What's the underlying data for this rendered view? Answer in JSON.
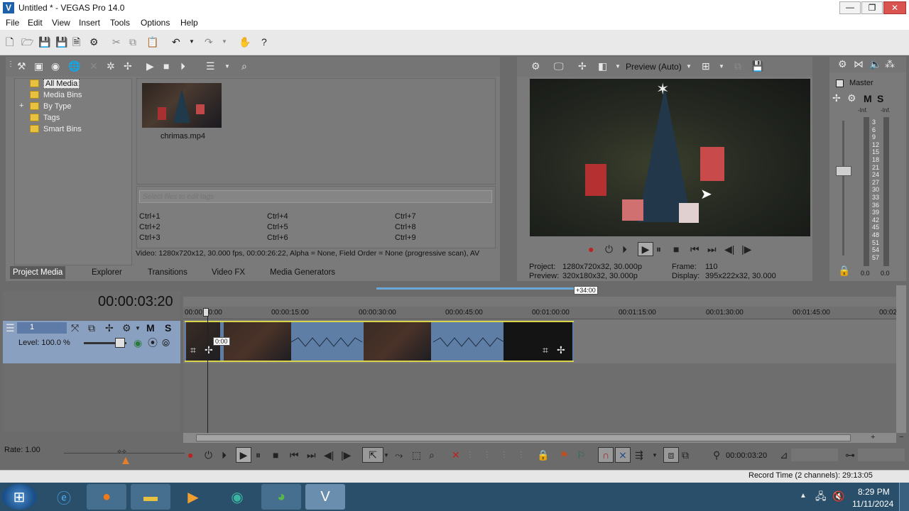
{
  "window": {
    "title": "Untitled * - VEGAS Pro 14.0"
  },
  "menu": [
    "File",
    "Edit",
    "View",
    "Insert",
    "Tools",
    "Options",
    "Help"
  ],
  "media_tree": [
    {
      "label": "All Media",
      "selected": true
    },
    {
      "label": "Media Bins"
    },
    {
      "label": "By Type",
      "expander": "+"
    },
    {
      "label": "Tags"
    },
    {
      "label": "Smart Bins"
    }
  ],
  "media_file": {
    "name": "chrimas.mp4"
  },
  "tags": {
    "placeholder": "Select files to edit tags",
    "shortcuts": [
      "Ctrl+1",
      "Ctrl+4",
      "Ctrl+7",
      "Ctrl+2",
      "Ctrl+5",
      "Ctrl+8",
      "Ctrl+3",
      "Ctrl+6",
      "Ctrl+9"
    ]
  },
  "media_info": "Video: 1280x720x12, 30.000 fps, 00:00:26:22, Alpha = None, Field Order = None (progressive scan), AV",
  "tabs": [
    "Project Media",
    "Explorer",
    "Transitions",
    "Video FX",
    "Media Generators"
  ],
  "preview": {
    "mode": "Preview (Auto)",
    "project_label": "Project:",
    "project_value": "1280x720x32, 30.000p",
    "preview_label": "Preview:",
    "preview_value": "320x180x32, 30.000p",
    "frame_label": "Frame:",
    "frame_value": "110",
    "display_label": "Display:",
    "display_value": "395x222x32, 30.000"
  },
  "master": {
    "label": "Master",
    "m": "M",
    "s": "S",
    "inf_left": "-Inf.",
    "inf_right": "-Inf.",
    "scale": [
      "3",
      "6",
      "9",
      "12",
      "15",
      "18",
      "21",
      "24",
      "27",
      "30",
      "33",
      "36",
      "39",
      "42",
      "45",
      "48",
      "51",
      "54",
      "57"
    ],
    "bottom_left": "0.0",
    "bottom_right": "0.0"
  },
  "timeline": {
    "timecode": "00:00:03:20",
    "region_label": "+34:00",
    "ruler": [
      "00:00:00:00",
      "00:00:15:00",
      "00:00:30:00",
      "00:00:45:00",
      "00:01:00:00",
      "00:01:15:00",
      "00:01:30:00",
      "00:01:45:00",
      "00:02"
    ],
    "clip_time": "0:00"
  },
  "track": {
    "number": "1",
    "m": "M",
    "s": "S",
    "level": "Level: 100.0 %"
  },
  "rate": "Rate: 1.00",
  "transport_timecode": "00:00:03:20",
  "status": "Record Time (2 channels): 29:13:05",
  "taskbar": {
    "time": "8:29 PM",
    "date": "11/11/2024"
  }
}
